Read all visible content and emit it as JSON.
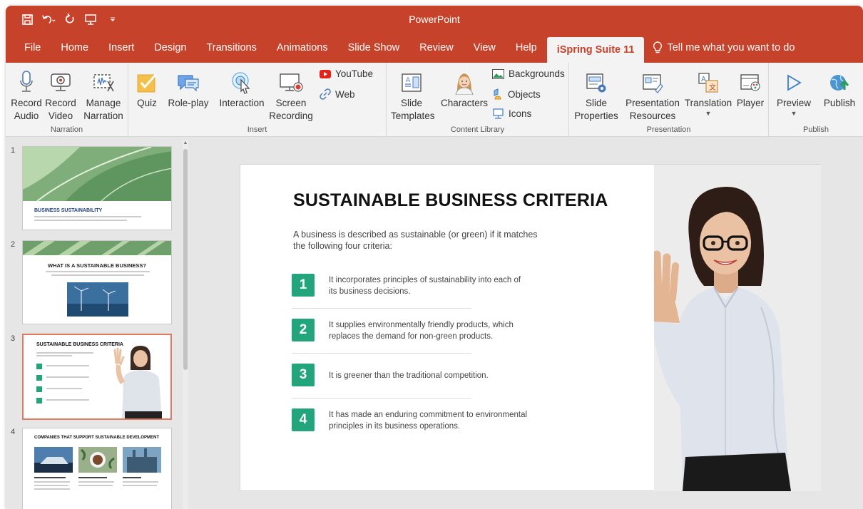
{
  "window": {
    "app_title": "PowerPoint",
    "accent": "#c6422a"
  },
  "tabs": [
    {
      "label": "File"
    },
    {
      "label": "Home"
    },
    {
      "label": "Insert"
    },
    {
      "label": "Design"
    },
    {
      "label": "Transitions"
    },
    {
      "label": "Animations"
    },
    {
      "label": "Slide Show"
    },
    {
      "label": "Review"
    },
    {
      "label": "View"
    },
    {
      "label": "Help"
    },
    {
      "label": "iSpring Suite 11",
      "active": true
    }
  ],
  "tell_me": "Tell me what you want to do",
  "ribbon": {
    "narration": {
      "label": "Narration",
      "record_audio": [
        "Record",
        "Audio"
      ],
      "record_video": [
        "Record",
        "Video"
      ],
      "manage_narration": [
        "Manage",
        "Narration"
      ]
    },
    "insert": {
      "label": "Insert",
      "quiz": "Quiz",
      "role_play": "Role-play",
      "interaction": "Interaction",
      "screen_recording": [
        "Screen",
        "Recording"
      ],
      "youtube": "YouTube",
      "web": "Web"
    },
    "content_library": {
      "label": "Content Library",
      "slide_templates": [
        "Slide",
        "Templates"
      ],
      "characters": "Characters",
      "backgrounds": "Backgrounds",
      "objects": "Objects",
      "icons": "Icons"
    },
    "presentation": {
      "label": "Presentation",
      "slide_properties": [
        "Slide",
        "Properties"
      ],
      "presentation_resources": [
        "Presentation",
        "Resources"
      ],
      "translation": "Translation",
      "player": "Player"
    },
    "publish": {
      "label": "Publish",
      "preview": "Preview",
      "publish": "Publish"
    }
  },
  "thumbnails": [
    {
      "num": "1",
      "title": "BUSINESS SUSTAINABILITY"
    },
    {
      "num": "2",
      "title": "WHAT IS A SUSTAINABLE BUSINESS?"
    },
    {
      "num": "3",
      "title": "SUSTAINABLE BUSINESS CRITERIA"
    },
    {
      "num": "4",
      "title": "COMPANIES THAT SUPPORT SUSTAINABLE DEVELOPMENT"
    }
  ],
  "slide": {
    "title": "SUSTAINABLE BUSINESS CRITERIA",
    "intro": "A business is described as sustainable (or green) if it matches the following four criteria:",
    "criteria": [
      {
        "num": "1",
        "text": "It incorporates principles of sustainability into each of its business decisions."
      },
      {
        "num": "2",
        "text": "It supplies environmentally friendly products, which replaces the demand for non-green products."
      },
      {
        "num": "3",
        "text": "It is greener than the traditional competition."
      },
      {
        "num": "4",
        "text": "It has made an enduring commitment to environmental principles in its business operations."
      }
    ],
    "accent": "#22a57a"
  }
}
